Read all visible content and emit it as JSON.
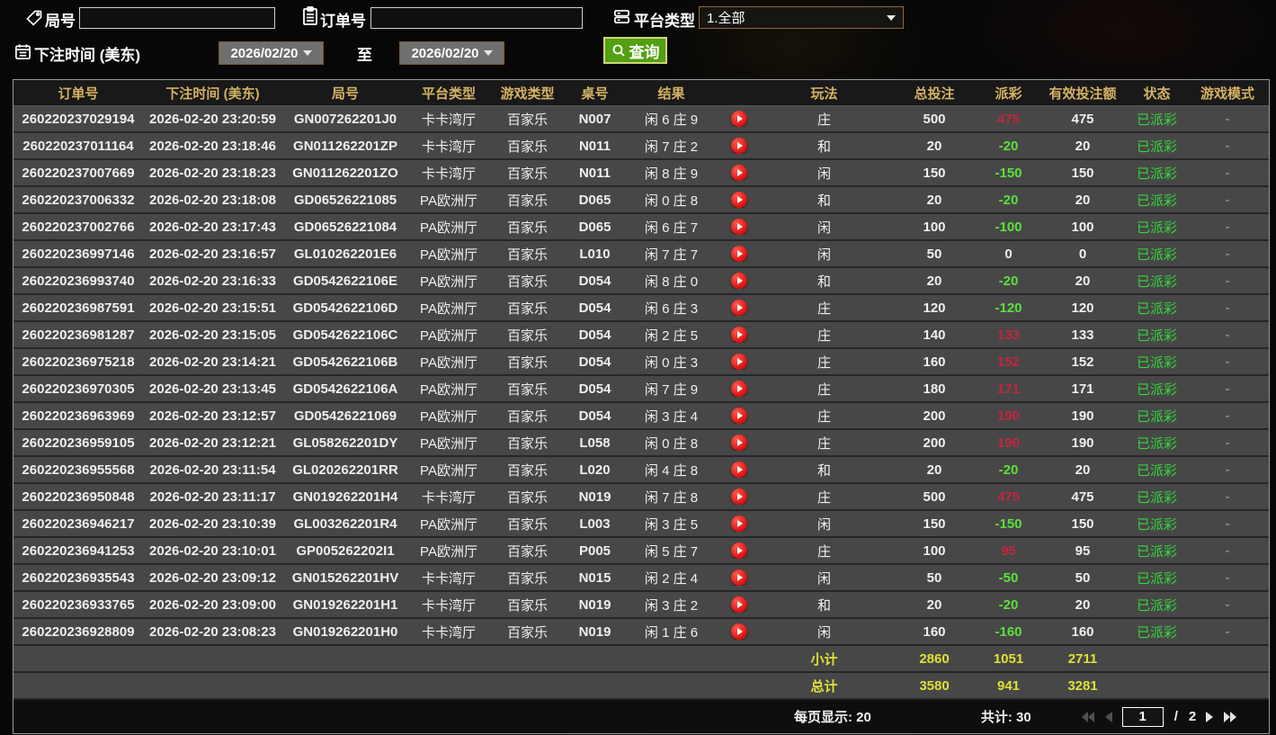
{
  "filters": {
    "round_label": "局号",
    "order_label": "订单号",
    "platform_label": "平台类型",
    "platform_value": "1.全部",
    "bet_time_label": "下注时间 (美东)",
    "to_label": "至",
    "date_from": "2026/02/20",
    "date_to": "2026/02/20",
    "search_label": "查询"
  },
  "table": {
    "columns": [
      "订单号",
      "下注时间 (美东)",
      "局号",
      "平台类型",
      "游戏类型",
      "桌号",
      "结果",
      "",
      "玩法",
      "总投注",
      "派彩",
      "有效投注额",
      "状态",
      "游戏模式"
    ],
    "rows": [
      {
        "order_no": "260220237029194",
        "bet_time": "2026-02-20 23:20:59",
        "round_no": "GN007262201J0",
        "platform": "卡卡湾厅",
        "game_type": "百家乐",
        "table_no": "N007",
        "result": "闲 6 庄 9",
        "play_type": "庄",
        "total_bet": "500",
        "payout": "475",
        "valid_bet": "475",
        "status": "已派彩",
        "game_mode": "-"
      },
      {
        "order_no": "260220237011164",
        "bet_time": "2026-02-20 23:18:46",
        "round_no": "GN011262201ZP",
        "platform": "卡卡湾厅",
        "game_type": "百家乐",
        "table_no": "N011",
        "result": "闲 7 庄 2",
        "play_type": "和",
        "total_bet": "20",
        "payout": "-20",
        "valid_bet": "20",
        "status": "已派彩",
        "game_mode": "-"
      },
      {
        "order_no": "260220237007669",
        "bet_time": "2026-02-20 23:18:23",
        "round_no": "GN011262201ZO",
        "platform": "卡卡湾厅",
        "game_type": "百家乐",
        "table_no": "N011",
        "result": "闲 8 庄 9",
        "play_type": "闲",
        "total_bet": "150",
        "payout": "-150",
        "valid_bet": "150",
        "status": "已派彩",
        "game_mode": "-"
      },
      {
        "order_no": "260220237006332",
        "bet_time": "2026-02-20 23:18:08",
        "round_no": "GD06526221085",
        "platform": "PA欧洲厅",
        "game_type": "百家乐",
        "table_no": "D065",
        "result": "闲 0 庄 8",
        "play_type": "和",
        "total_bet": "20",
        "payout": "-20",
        "valid_bet": "20",
        "status": "已派彩",
        "game_mode": "-"
      },
      {
        "order_no": "260220237002766",
        "bet_time": "2026-02-20 23:17:43",
        "round_no": "GD06526221084",
        "platform": "PA欧洲厅",
        "game_type": "百家乐",
        "table_no": "D065",
        "result": "闲 6 庄 7",
        "play_type": "闲",
        "total_bet": "100",
        "payout": "-100",
        "valid_bet": "100",
        "status": "已派彩",
        "game_mode": "-"
      },
      {
        "order_no": "260220236997146",
        "bet_time": "2026-02-20 23:16:57",
        "round_no": "GL010262201E6",
        "platform": "PA欧洲厅",
        "game_type": "百家乐",
        "table_no": "L010",
        "result": "闲 7 庄 7",
        "play_type": "闲",
        "total_bet": "50",
        "payout": "0",
        "valid_bet": "0",
        "status": "已派彩",
        "game_mode": "-"
      },
      {
        "order_no": "260220236993740",
        "bet_time": "2026-02-20 23:16:33",
        "round_no": "GD0542622106E",
        "platform": "PA欧洲厅",
        "game_type": "百家乐",
        "table_no": "D054",
        "result": "闲 8 庄 0",
        "play_type": "和",
        "total_bet": "20",
        "payout": "-20",
        "valid_bet": "20",
        "status": "已派彩",
        "game_mode": "-"
      },
      {
        "order_no": "260220236987591",
        "bet_time": "2026-02-20 23:15:51",
        "round_no": "GD0542622106D",
        "platform": "PA欧洲厅",
        "game_type": "百家乐",
        "table_no": "D054",
        "result": "闲 6 庄 3",
        "play_type": "庄",
        "total_bet": "120",
        "payout": "-120",
        "valid_bet": "120",
        "status": "已派彩",
        "game_mode": "-"
      },
      {
        "order_no": "260220236981287",
        "bet_time": "2026-02-20 23:15:05",
        "round_no": "GD0542622106C",
        "platform": "PA欧洲厅",
        "game_type": "百家乐",
        "table_no": "D054",
        "result": "闲 2 庄 5",
        "play_type": "庄",
        "total_bet": "140",
        "payout": "133",
        "valid_bet": "133",
        "status": "已派彩",
        "game_mode": "-"
      },
      {
        "order_no": "260220236975218",
        "bet_time": "2026-02-20 23:14:21",
        "round_no": "GD0542622106B",
        "platform": "PA欧洲厅",
        "game_type": "百家乐",
        "table_no": "D054",
        "result": "闲 0 庄 3",
        "play_type": "庄",
        "total_bet": "160",
        "payout": "152",
        "valid_bet": "152",
        "status": "已派彩",
        "game_mode": "-"
      },
      {
        "order_no": "260220236970305",
        "bet_time": "2026-02-20 23:13:45",
        "round_no": "GD0542622106A",
        "platform": "PA欧洲厅",
        "game_type": "百家乐",
        "table_no": "D054",
        "result": "闲 7 庄 9",
        "play_type": "庄",
        "total_bet": "180",
        "payout": "171",
        "valid_bet": "171",
        "status": "已派彩",
        "game_mode": "-"
      },
      {
        "order_no": "260220236963969",
        "bet_time": "2026-02-20 23:12:57",
        "round_no": "GD05426221069",
        "platform": "PA欧洲厅",
        "game_type": "百家乐",
        "table_no": "D054",
        "result": "闲 3 庄 4",
        "play_type": "庄",
        "total_bet": "200",
        "payout": "190",
        "valid_bet": "190",
        "status": "已派彩",
        "game_mode": "-"
      },
      {
        "order_no": "260220236959105",
        "bet_time": "2026-02-20 23:12:21",
        "round_no": "GL058262201DY",
        "platform": "PA欧洲厅",
        "game_type": "百家乐",
        "table_no": "L058",
        "result": "闲 0 庄 8",
        "play_type": "庄",
        "total_bet": "200",
        "payout": "190",
        "valid_bet": "190",
        "status": "已派彩",
        "game_mode": "-"
      },
      {
        "order_no": "260220236955568",
        "bet_time": "2026-02-20 23:11:54",
        "round_no": "GL020262201RR",
        "platform": "PA欧洲厅",
        "game_type": "百家乐",
        "table_no": "L020",
        "result": "闲 4 庄 8",
        "play_type": "和",
        "total_bet": "20",
        "payout": "-20",
        "valid_bet": "20",
        "status": "已派彩",
        "game_mode": "-"
      },
      {
        "order_no": "260220236950848",
        "bet_time": "2026-02-20 23:11:17",
        "round_no": "GN019262201H4",
        "platform": "卡卡湾厅",
        "game_type": "百家乐",
        "table_no": "N019",
        "result": "闲 7 庄 8",
        "play_type": "庄",
        "total_bet": "500",
        "payout": "475",
        "valid_bet": "475",
        "status": "已派彩",
        "game_mode": "-"
      },
      {
        "order_no": "260220236946217",
        "bet_time": "2026-02-20 23:10:39",
        "round_no": "GL003262201R4",
        "platform": "PA欧洲厅",
        "game_type": "百家乐",
        "table_no": "L003",
        "result": "闲 3 庄 5",
        "play_type": "闲",
        "total_bet": "150",
        "payout": "-150",
        "valid_bet": "150",
        "status": "已派彩",
        "game_mode": "-"
      },
      {
        "order_no": "260220236941253",
        "bet_time": "2026-02-20 23:10:01",
        "round_no": "GP005262202I1",
        "platform": "PA欧洲厅",
        "game_type": "百家乐",
        "table_no": "P005",
        "result": "闲 5 庄 7",
        "play_type": "庄",
        "total_bet": "100",
        "payout": "95",
        "valid_bet": "95",
        "status": "已派彩",
        "game_mode": "-"
      },
      {
        "order_no": "260220236935543",
        "bet_time": "2026-02-20 23:09:12",
        "round_no": "GN015262201HV",
        "platform": "卡卡湾厅",
        "game_type": "百家乐",
        "table_no": "N015",
        "result": "闲 2 庄 4",
        "play_type": "闲",
        "total_bet": "50",
        "payout": "-50",
        "valid_bet": "50",
        "status": "已派彩",
        "game_mode": "-"
      },
      {
        "order_no": "260220236933765",
        "bet_time": "2026-02-20 23:09:00",
        "round_no": "GN019262201H1",
        "platform": "卡卡湾厅",
        "game_type": "百家乐",
        "table_no": "N019",
        "result": "闲 3 庄 2",
        "play_type": "和",
        "total_bet": "20",
        "payout": "-20",
        "valid_bet": "20",
        "status": "已派彩",
        "game_mode": "-"
      },
      {
        "order_no": "260220236928809",
        "bet_time": "2026-02-20 23:08:23",
        "round_no": "GN019262201H0",
        "platform": "卡卡湾厅",
        "game_type": "百家乐",
        "table_no": "N019",
        "result": "闲 1 庄 6",
        "play_type": "闲",
        "total_bet": "160",
        "payout": "-160",
        "valid_bet": "160",
        "status": "已派彩",
        "game_mode": "-"
      }
    ]
  },
  "totals": {
    "subtotal_label": "小计",
    "subtotal": [
      "2860",
      "1051",
      "2711"
    ],
    "grand_label": "总计",
    "grand": [
      "3580",
      "941",
      "3281"
    ]
  },
  "pagination": {
    "per_page_label": "每页显示: 20",
    "total_label": "共计: 30",
    "current_page": "1",
    "page_sep": "/",
    "total_pages": "2"
  },
  "colors": {
    "header_gold": "#d4b264",
    "search_green": "#53a012",
    "payout_win_red": "#c0273e",
    "payout_loss_green": "#5ce03c",
    "status_green": "#35d53a",
    "totals_yellow": "#dde135",
    "date_border_brown": "#7b5a2e"
  }
}
